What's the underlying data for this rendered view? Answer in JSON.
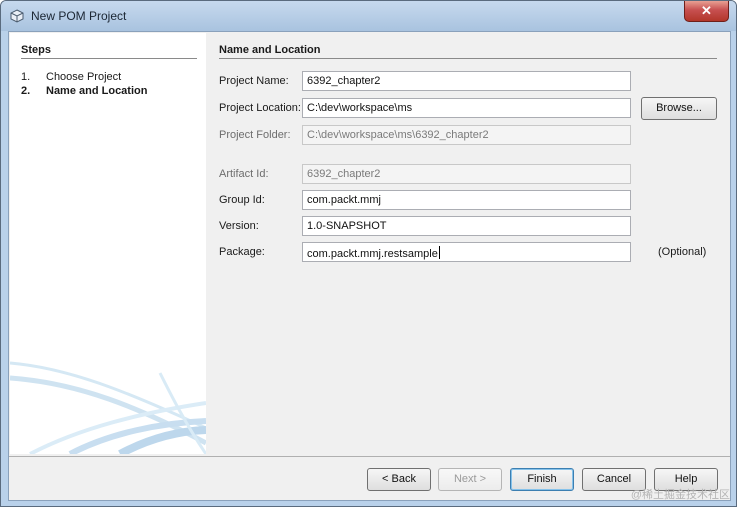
{
  "window": {
    "title": "New POM Project",
    "close_label": "✕",
    "app_icon": "netbeans-cube-icon"
  },
  "steps": {
    "title": "Steps",
    "items": [
      {
        "num": "1.",
        "label": "Choose Project"
      },
      {
        "num": "2.",
        "label": "Name and Location"
      }
    ]
  },
  "panel": {
    "title": "Name and Location",
    "fields": {
      "project_name": {
        "label": "Project Name:",
        "value": "6392_chapter2"
      },
      "project_location": {
        "label": "Project Location:",
        "value": "C:\\dev\\workspace\\ms"
      },
      "project_folder": {
        "label": "Project Folder:",
        "value": "C:\\dev\\workspace\\ms\\6392_chapter2"
      },
      "artifact_id": {
        "label": "Artifact Id:",
        "value": "6392_chapter2"
      },
      "group_id": {
        "label": "Group Id:",
        "value": "com.packt.mmj"
      },
      "version": {
        "label": "Version:",
        "value": "1.0-SNAPSHOT"
      },
      "package": {
        "label": "Package:",
        "value": "com.packt.mmj.restsample"
      }
    },
    "browse_label": "Browse...",
    "optional_label": "(Optional)"
  },
  "buttons": {
    "back": "< Back",
    "next": "Next >",
    "finish": "Finish",
    "cancel": "Cancel",
    "help": "Help"
  },
  "watermark": "@稀土掘金技术社区"
}
